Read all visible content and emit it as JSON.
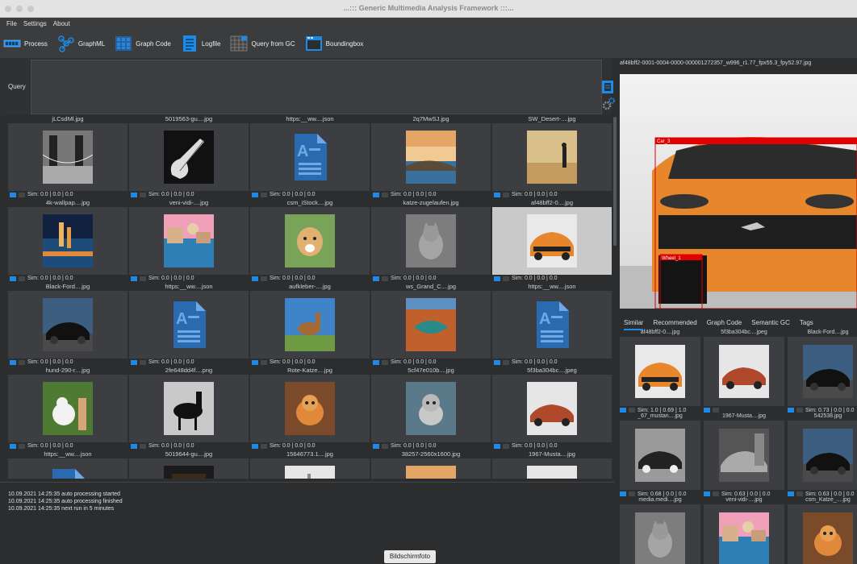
{
  "window": {
    "title": "...::: Generic Multimedia Analysis Framework :::..."
  },
  "menu": [
    "File",
    "Settings",
    "About"
  ],
  "toolbar": {
    "process": "Process",
    "graphml": "GraphML",
    "graph_code": "Graph Code",
    "logfile": "Logfile",
    "query_gc": "Query from GC",
    "boundingbox": "Boundingbox"
  },
  "query": {
    "label": "Query"
  },
  "grid": {
    "items": [
      {
        "name": "jLCsdMl.jpg",
        "sim": "Sim: 0.0 | 0.0 | 0.0",
        "kind": "bridge"
      },
      {
        "name": "5019563-gu....jpg",
        "sim": "Sim: 0.0 | 0.0 | 0.0",
        "kind": "guitar"
      },
      {
        "name": "https:__ww....json",
        "sim": "Sim: 0.0 | 0.0 | 0.0",
        "kind": "doc"
      },
      {
        "name": "2q7MwSJ.jpg",
        "sim": "Sim: 0.0 | 0.0 | 0.0",
        "kind": "coast"
      },
      {
        "name": "SW_Desert-....jpg",
        "sim": "Sim: 0.0 | 0.0 | 0.0",
        "kind": "desert"
      },
      {
        "name": "4k-wallpap....jpg",
        "sim": "Sim: 0.0 | 0.0 | 0.0",
        "kind": "city"
      },
      {
        "name": "veni-vidi-....jpg",
        "sim": "Sim: 0.0 | 0.0 | 0.0",
        "kind": "venice"
      },
      {
        "name": "csm_iStock....jpg",
        "sim": "Sim: 0.0 | 0.0 | 0.0",
        "kind": "puppy"
      },
      {
        "name": "katze-zugelaufen.jpg",
        "sim": "Sim: 0.0 | 0.0 | 0.0",
        "kind": "cat"
      },
      {
        "name": "af48bff2-0....jpg",
        "sim": "Sim: 0.0 | 0.0 | 0.0",
        "kind": "mustang",
        "selected": true
      },
      {
        "name": "Black-Ford....jpg",
        "sim": "Sim: 0.0 | 0.0 | 0.0",
        "kind": "blackcar"
      },
      {
        "name": "https:__ww....json",
        "sim": "Sim: 0.0 | 0.0 | 0.0",
        "kind": "doc"
      },
      {
        "name": "aufkleber-....jpg",
        "sim": "Sim: 0.0 | 0.0 | 0.0",
        "kind": "horse"
      },
      {
        "name": "ws_Grand_C....jpg",
        "sim": "Sim: 0.0 | 0.0 | 0.0",
        "kind": "canyon"
      },
      {
        "name": "https:__ww....json",
        "sim": "Sim: 0.0 | 0.0 | 0.0",
        "kind": "doc"
      },
      {
        "name": "hund-290-r....jpg",
        "sim": "Sim: 0.0 | 0.0 | 0.0",
        "kind": "dog"
      },
      {
        "name": "2fe648dd4f....png",
        "sim": "Sim: 0.0 | 0.0 | 0.0",
        "kind": "blackhorse"
      },
      {
        "name": "Rote-Katze....jpg",
        "sim": "Sim: 0.0 | 0.0 | 0.0",
        "kind": "kitten"
      },
      {
        "name": "5cf47e010b....jpg",
        "sim": "Sim: 0.0 | 0.0 | 0.0",
        "kind": "greykitten"
      },
      {
        "name": "5f3ba304bc....jpeg",
        "sim": "Sim: 0.0 | 0.0 | 0.0",
        "kind": "redcar"
      },
      {
        "name": "https:__ww....json",
        "sim": "",
        "kind": "doc"
      },
      {
        "name": "5019644-gu....jpg",
        "sim": "",
        "kind": "dark"
      },
      {
        "name": "15646773.1....jpg",
        "sim": "",
        "kind": "light"
      },
      {
        "name": "38257-2560x1600.jpg",
        "sim": "",
        "kind": "coast"
      },
      {
        "name": "1967-Musta....jpg",
        "sim": "",
        "kind": "redcar"
      }
    ]
  },
  "log": {
    "lines": [
      "10.09.2021 14:25:35   auto processing started",
      "10.09.2021 14:25:35   auto processing finished",
      "10.09.2021 14:25:35   next run in 5 minutes"
    ]
  },
  "preview": {
    "title": "af48bff2-0001-0004-0000-000001272357_w996_r1.77_fpx55.3_fpy52.97.jpg",
    "box1_label": "Car_3",
    "box2_label": "Wheel_1"
  },
  "tabs": [
    "Similar",
    "Recommended",
    "Graph Code",
    "Semantic GC",
    "Tags"
  ],
  "related": {
    "items": [
      {
        "name": "af48bff2-0....jpg",
        "sim": "Sim: 1.0 | 0.69 | 1.0",
        "kind": "mustang"
      },
      {
        "name": "5f3ba304bc....jpeg",
        "sim": "",
        "kind": "redcar"
      },
      {
        "name": "Black-Ford....jpg",
        "sim": "Sim: 0.73 | 0.0 | 0.0",
        "kind": "blackcar"
      },
      {
        "name": "_67_mustan....jpg",
        "sim": "Sim: 0.68 | 0.0 | 0.0",
        "kind": "bwcar"
      },
      {
        "name": "1967-Musta....jpg",
        "sim": "Sim: 0.63 | 0.0 | 0.0",
        "kind": "bwcar2"
      },
      {
        "name": "542538.jpg",
        "sim": "Sim: 0.63 | 0.0 | 0.0",
        "kind": "blackcar"
      },
      {
        "name": "media.medi....jpg",
        "sim": "",
        "kind": "cat"
      },
      {
        "name": "veni-vidi-....jpg",
        "sim": "Sim: 0.15 | 0.0 | 0.0",
        "kind": "venice"
      },
      {
        "name": "csm_Katze_....jpg",
        "sim": "",
        "kind": "kitten"
      }
    ]
  },
  "tooltip": "Bildschirmfoto"
}
